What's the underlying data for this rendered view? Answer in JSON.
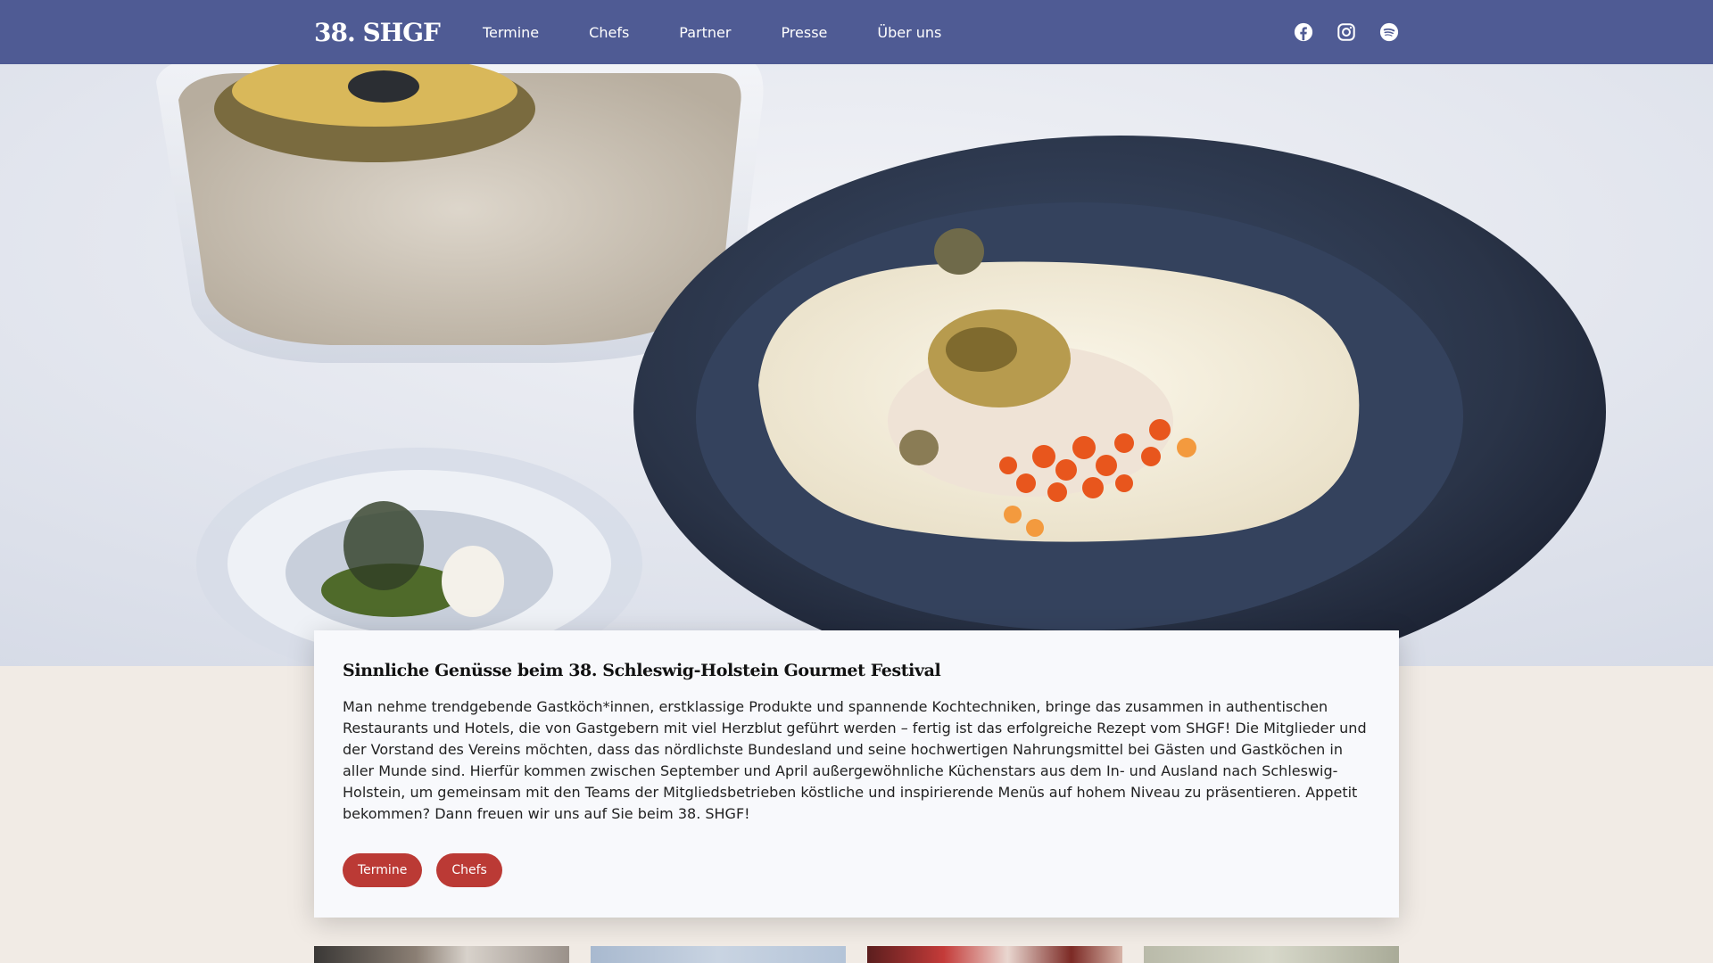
{
  "nav": {
    "logo": "38. SHGF",
    "links": [
      "Termine",
      "Chefs",
      "Partner",
      "Presse",
      "Über uns"
    ],
    "social": [
      "facebook-icon",
      "instagram-icon",
      "spotify-icon"
    ]
  },
  "hero": {
    "image": "plated-scallop-with-caviar-and-oyster-jars"
  },
  "card": {
    "title": "Sinnliche Genüsse beim 38. Schleswig-Holstein Gourmet Festival",
    "text": "Man nehme trendgebende Gastköch*innen, erstklassige Produkte und spannende Kochtechniken, bringe das zusammen in authentischen Restaurants und Hotels, die von Gastgebern mit viel Herzblut geführt werden – fertig ist das erfolgreiche Rezept vom SHGF! Die Mitglieder und der Vorstand des Vereins möchten, dass das nördlichste Bundesland und seine hochwertigen Nahrungsmittel bei Gästen und Gastköchen in aller Munde sind. Hierfür kommen zwischen September und April außergewöhnliche Küchenstars aus dem In- und Ausland nach Schleswig-Holstein, um gemeinsam mit den Teams der Mitgliedsbetrieben köstliche und inspirierende Menüs auf hohem Niveau zu präsentieren. Appetit bekommen? Dann freuen wir uns auf Sie beim 38. SHGF!",
    "buttons": [
      "Termine",
      "Chefs"
    ]
  },
  "colors": {
    "nav": "#4f5b94",
    "accent": "#bb3a35",
    "page": "#f1ebe5"
  }
}
